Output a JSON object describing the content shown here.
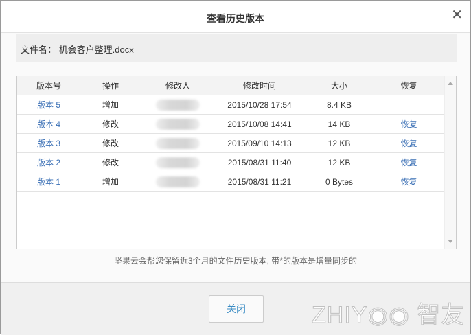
{
  "dialog": {
    "title": "查看历史版本",
    "close_icon": "close-icon"
  },
  "file": {
    "label": "文件名：",
    "name": "机会客户整理.docx"
  },
  "table": {
    "headers": [
      "版本号",
      "操作",
      "修改人",
      "修改时间",
      "大小",
      "恢复"
    ],
    "rows": [
      {
        "version": "版本 5",
        "action": "增加",
        "time": "2015/10/28 17:54",
        "size": "8.4 KB",
        "restore": ""
      },
      {
        "version": "版本 4",
        "action": "修改",
        "time": "2015/10/08 14:41",
        "size": "14 KB",
        "restore": "恢复"
      },
      {
        "version": "版本 3",
        "action": "修改",
        "time": "2015/09/10 14:13",
        "size": "12 KB",
        "restore": "恢复"
      },
      {
        "version": "版本 2",
        "action": "修改",
        "time": "2015/08/31 11:40",
        "size": "12 KB",
        "restore": "恢复"
      },
      {
        "version": "版本 1",
        "action": "增加",
        "time": "2015/08/31 11:21",
        "size": "0 Bytes",
        "restore": "恢复"
      }
    ]
  },
  "note": "坚果云会帮您保留近3个月的文件历史版本, 带*的版本是增量同步的",
  "footer": {
    "close_label": "关闭",
    "watermark": "ZHIYOO 智友"
  }
}
